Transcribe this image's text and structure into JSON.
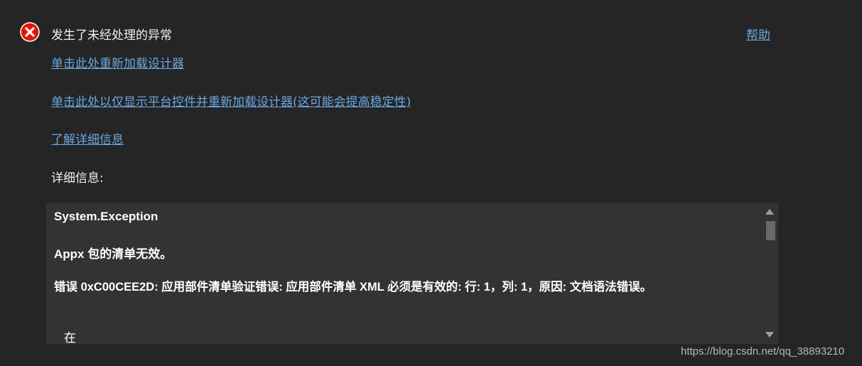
{
  "header": {
    "title": "发生了未经处理的异常",
    "help_label": "帮助",
    "icon": "error-icon"
  },
  "links": {
    "reload_designer": "单击此处重新加载设计器",
    "reload_platform_only": "单击此处以仅显示平台控件并重新加载设计器(这可能会提高稳定性)",
    "learn_more": "了解详细信息"
  },
  "details": {
    "label": "详细信息:",
    "exception_type": "System.Exception",
    "message": "Appx 包的清单无效。",
    "error_line": "错误 0xC00CEE2D: 应用部件清单验证错误: 应用部件清单 XML 必须是有效的: 行: 1，列: 1，原因: 文档语法错误。",
    "stack_start": "在"
  },
  "watermark": "https://blog.csdn.net/qq_38893210",
  "colors": {
    "background": "#252526",
    "link": "#6aa7e0",
    "details_background": "#333334",
    "error_red": "#e51400"
  }
}
